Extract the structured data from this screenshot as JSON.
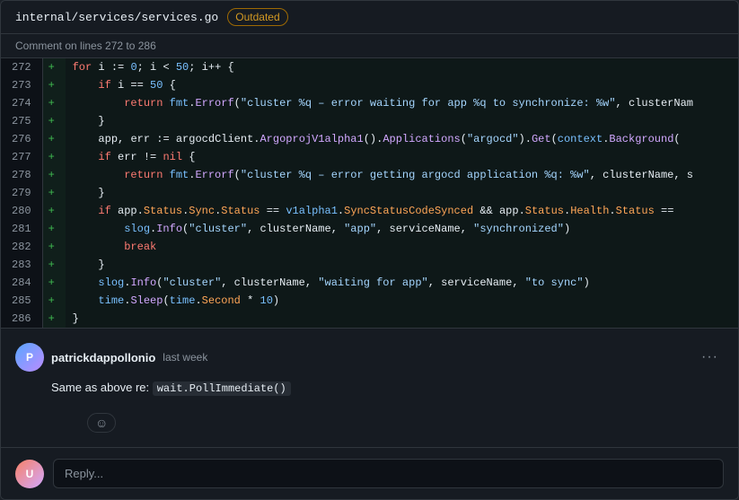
{
  "header": {
    "file_path": "internal/services/services.go",
    "outdated_label": "Outdated"
  },
  "lines_comment": {
    "text": "Comment on lines 272 to 286"
  },
  "code": {
    "lines": [
      {
        "num": "272",
        "sign": "+",
        "content": "for i := 0; i < 50; i++ {"
      },
      {
        "num": "273",
        "sign": "+",
        "content": "    if i == 50 {"
      },
      {
        "num": "274",
        "sign": "+",
        "content": "        return fmt.Errorf(\"cluster %q – error waiting for app %q to synchronize: %w\", clusterNam"
      },
      {
        "num": "275",
        "sign": "+",
        "content": "    }"
      },
      {
        "num": "276",
        "sign": "+",
        "content": "    app, err := argocdClient.ArgoprojV1alpha1().Applications(\"argocd\").Get(context.Background("
      },
      {
        "num": "277",
        "sign": "+",
        "content": "    if err != nil {"
      },
      {
        "num": "278",
        "sign": "+",
        "content": "        return fmt.Errorf(\"cluster %q – error getting argocd application %q: %w\", clusterName, s"
      },
      {
        "num": "279",
        "sign": "+",
        "content": "    }"
      },
      {
        "num": "280",
        "sign": "+",
        "content": "    if app.Status.Sync.Status == v1alpha1.SyncStatusCodeSynced && app.Status.Health.Status =="
      },
      {
        "num": "281",
        "sign": "+",
        "content": "        slog.Info(\"cluster\", clusterName, \"app\", serviceName, \"synchronized\")"
      },
      {
        "num": "282",
        "sign": "+",
        "content": "        break"
      },
      {
        "num": "283",
        "sign": "+",
        "content": "    }"
      },
      {
        "num": "284",
        "sign": "+",
        "content": "    slog.Info(\"cluster\", clusterName, \"waiting for app\", serviceName, \"to sync\")"
      },
      {
        "num": "285",
        "sign": "+",
        "content": "    time.Sleep(time.Second * 10)"
      },
      {
        "num": "286",
        "sign": "+",
        "content": "}"
      }
    ]
  },
  "comment": {
    "username": "patrickdappollonio",
    "timestamp": "last week",
    "body_prefix": "Same as above re: ",
    "body_code": "wait.PollImmediate()",
    "emoji": "☺",
    "more_options": "···"
  },
  "reply": {
    "placeholder": "Reply..."
  }
}
